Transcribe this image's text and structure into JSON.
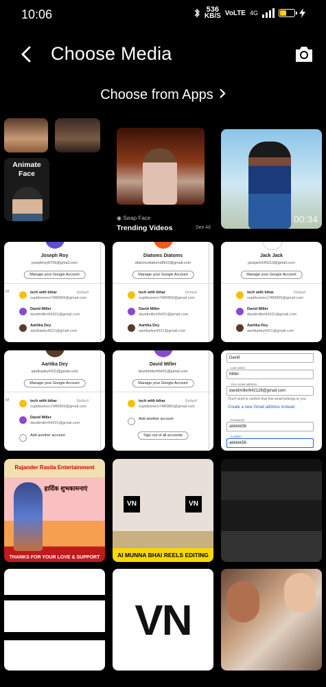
{
  "status_bar": {
    "time": "10:06",
    "net_speed": "536",
    "net_unit": "KB/S",
    "volte": "VoLTE",
    "network_type": "4G",
    "colors": {
      "battery_fill": "#ffd400"
    }
  },
  "header": {
    "title": "Choose Media"
  },
  "apps_link": {
    "label": "Choose from Apps"
  },
  "feature": {
    "animate_face": "Animate\nFace",
    "swap_face": "Swap Face",
    "trending": "Trending Videos",
    "see_all": "See All",
    "video_timestamp": "00:34"
  },
  "account_cards": [
    {
      "name": "Joseph Roy",
      "email": "josephroy8709@gmail.com",
      "manage": "Manage your Google Account",
      "rows": [
        {
          "title": "tech with bihar",
          "sub": "suptibumers7480869@gmail.com",
          "tag": "Default",
          "color": "#f5c000"
        },
        {
          "title": "David Miller",
          "sub": "davidmiller66431@gmail.com",
          "tag": "",
          "color": "#8a4ad0"
        },
        {
          "title": "Aartika Dey",
          "sub": "aartikadey4321@gmail.com",
          "tag": "",
          "color": "#5a3a2a"
        }
      ]
    },
    {
      "name": "Diatoms Diatoms",
      "email": "diatomsdiatoms8910@gmail.com",
      "manage": "Manage your Google Account",
      "rows": [
        {
          "title": "tech with bihar",
          "sub": "suptibumers7480869@gmail.com",
          "tag": "Default",
          "color": "#f5c000"
        },
        {
          "title": "David Miller",
          "sub": "davidmiller66431@gmail.com",
          "tag": "",
          "color": "#8a4ad0"
        },
        {
          "title": "Aartika Dey",
          "sub": "aartikadey4321@gmail.com",
          "tag": "",
          "color": "#5a3a2a"
        }
      ]
    },
    {
      "name": "Jack Jack",
      "email": "jackjack543213@gmail.com",
      "manage": "Manage your Google Account",
      "rows": [
        {
          "title": "tech with bihar",
          "sub": "suptibumers7480869@gmail.com",
          "tag": "Default",
          "color": "#f5c000"
        },
        {
          "title": "David Miller",
          "sub": "davidmiller66431@gmail.com",
          "tag": "",
          "color": "#8a4ad0"
        },
        {
          "title": "Aartika Dey",
          "sub": "aartikadey4321@gmail.com",
          "tag": "",
          "color": "#5a3a2a"
        }
      ]
    },
    {
      "name": "Aartika Dey",
      "email": "aartikadey4321@gmail.com",
      "manage": "Manage your Google Account",
      "rows": [
        {
          "title": "tech with bihar",
          "sub": "suptibumers7480869@gmail.com",
          "tag": "Default",
          "color": "#f5c000"
        },
        {
          "title": "David Miller",
          "sub": "davidmiller66431@gmail.com",
          "tag": "",
          "color": "#8a4ad0"
        },
        {
          "title": "Add another account",
          "sub": "",
          "tag": "",
          "color": "#ffffff"
        }
      ]
    },
    {
      "name": "David Miller",
      "email": "davidmiller66431@gmail.com",
      "manage": "Manage your Google Account",
      "rows": [
        {
          "title": "tech with bihar",
          "sub": "suptibumers7480869@gmail.com",
          "tag": "Default",
          "color": "#f5c000"
        },
        {
          "title": "Add another account",
          "sub": "",
          "tag": "",
          "color": "#ffffff"
        },
        {
          "title": "Sign out of all accounts",
          "sub": "",
          "tag": "",
          "color": "#ffffff"
        }
      ]
    }
  ],
  "signup_form": {
    "first_name": "David",
    "last_name_label": "Last name",
    "last_name": "Miller",
    "email_label": "Your email address",
    "email": "davidmiller642128@gmail.com",
    "confirm_note": "You'll need to confirm that this email belongs to you.",
    "create_link": "Create a new Gmail address instead",
    "password_label": "Password",
    "password": "akkkkk56",
    "confirm_label": "Confirm",
    "confirm": "akkkkk56"
  },
  "poster": {
    "top": "Rajander Rasila Entertainment",
    "middle": "हार्दिक शुभकामनाएं",
    "bottom": "THANKS FOR YOUR LOVE & SUPPORT"
  },
  "vn_clip": {
    "badge": "VN",
    "strip": "AI MUNNA BHAI REELS EDITING"
  },
  "vn_logo": {
    "text": "VN"
  }
}
